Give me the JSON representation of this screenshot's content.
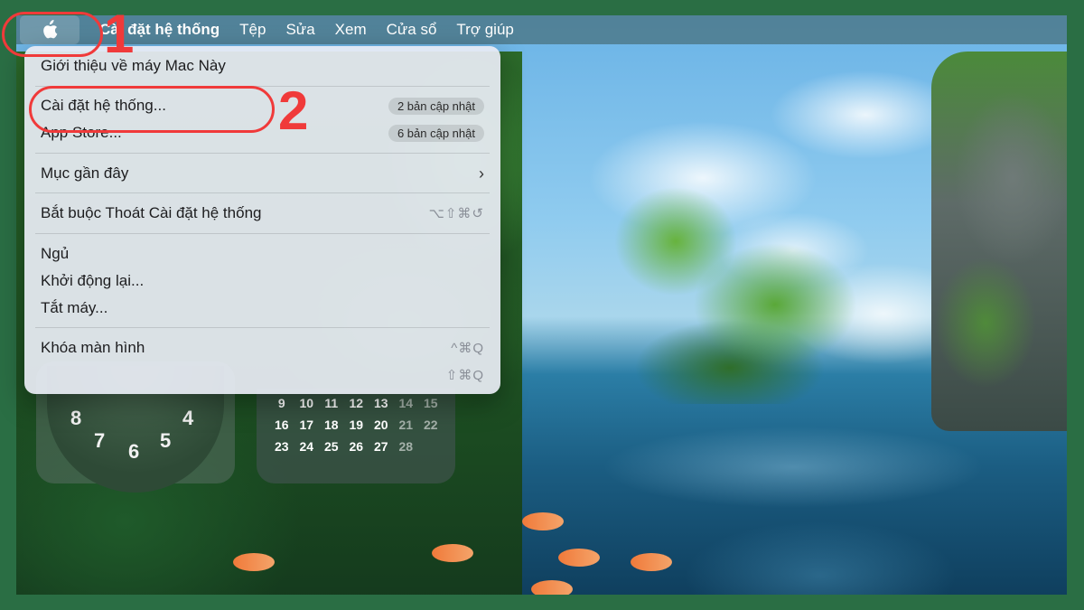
{
  "menubar": {
    "app_name": "Cài đặt hệ thống",
    "items": [
      "Tệp",
      "Sửa",
      "Xem",
      "Cửa sổ",
      "Trợ giúp"
    ]
  },
  "apple_menu": {
    "about": "Giới thiệu về máy Mac Này",
    "settings": "Cài đặt hệ thống...",
    "settings_badge": "2 bản cập nhật",
    "app_store": "App Store...",
    "app_store_badge": "6 bản cập nhật",
    "recent": "Mục gần đây",
    "force_quit": "Bắt buộc Thoát Cài đặt hệ thống",
    "force_quit_shortcut": "⌥⇧⌘↺",
    "sleep": "Ngủ",
    "restart": "Khởi động lại...",
    "shutdown": "Tắt máy...",
    "lock": "Khóa màn hình",
    "lock_shortcut": "^⌘Q",
    "logout_shortcut": "⇧⌘Q"
  },
  "annotations": {
    "step1": "1",
    "step2": "2"
  },
  "clock_widget": {
    "numbers": [
      "8",
      "4",
      "7",
      "5",
      "6"
    ]
  },
  "calendar_widget": {
    "rows": [
      [
        "9",
        "10",
        "11",
        "12",
        "13",
        "14",
        "15"
      ],
      [
        "16",
        "17",
        "18",
        "19",
        "20",
        "21",
        "22"
      ],
      [
        "23",
        "24",
        "25",
        "26",
        "27",
        "28",
        ""
      ]
    ]
  },
  "colors": {
    "annotation": "#f03a3a",
    "frame": "#2a6e44"
  }
}
